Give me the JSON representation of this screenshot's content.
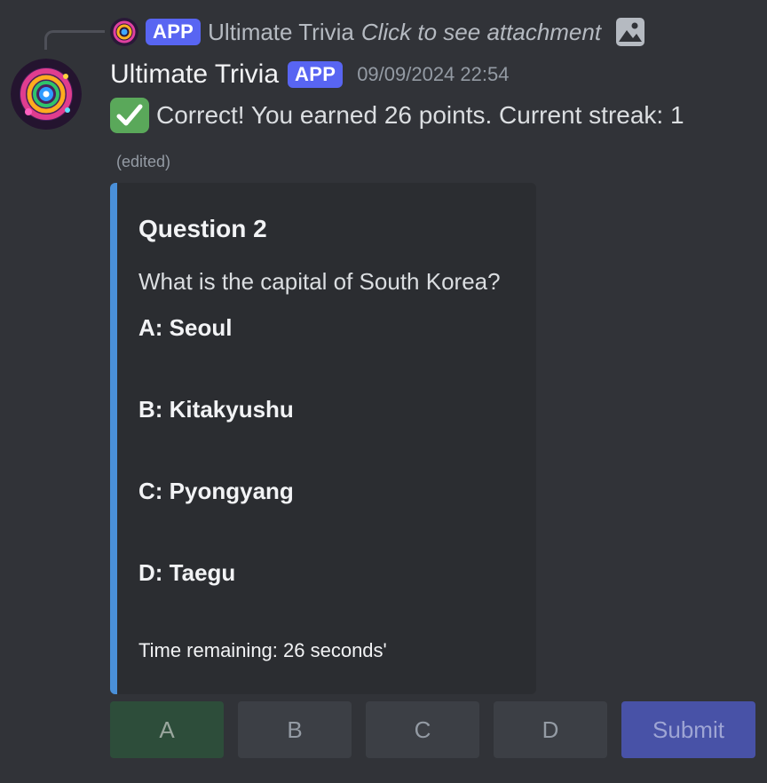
{
  "reply": {
    "tag": "APP",
    "name": "Ultimate Trivia",
    "attachment_text": "Click to see attachment",
    "icon": "image-icon"
  },
  "message": {
    "username": "Ultimate Trivia",
    "tag": "APP",
    "timestamp": "09/09/2024 22:54",
    "text": "Correct! You earned 26 points. Current streak: 1",
    "icon": "check-mark-icon",
    "edited": "(edited)"
  },
  "embed": {
    "accent_color": "#4a90d9",
    "title": "Question 2",
    "question": "What is the capital of South Korea?",
    "answers": [
      "A: Seoul",
      "B: Kitakyushu",
      "C: Pyongyang",
      "D: Taegu"
    ],
    "timer": "Time remaining: 26 seconds'"
  },
  "buttons": {
    "a": "A",
    "b": "B",
    "c": "C",
    "d": "D",
    "submit": "Submit"
  },
  "colors": {
    "background": "#313338",
    "brand": "#5865f2",
    "success": "#5aa85a"
  }
}
